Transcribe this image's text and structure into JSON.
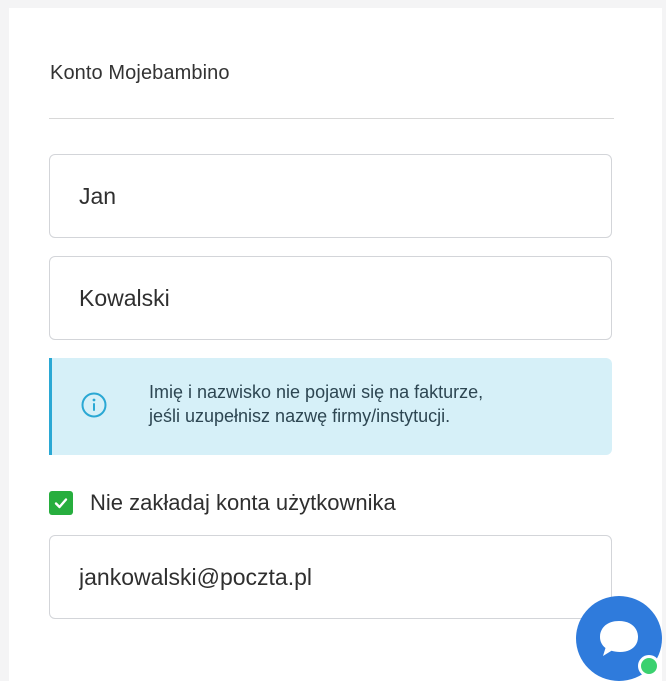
{
  "section": {
    "title": "Konto Mojebambino"
  },
  "form": {
    "first_name": {
      "value": "Jan"
    },
    "last_name": {
      "value": "Kowalski"
    },
    "info": {
      "icon": "info-icon",
      "line1": "Imię i nazwisko nie pojawi się na fakturze,",
      "line2": "jeśli uzupełnisz nazwę firmy/instytucji."
    },
    "no_account": {
      "checked": true,
      "label": "Nie zakładaj konta użytkownika"
    },
    "email": {
      "value": "jankowalski@poczta.pl"
    }
  },
  "chat": {
    "icon": "chat-bubble-icon",
    "status_color": "#3bd16f"
  },
  "colors": {
    "info_background": "#d6f0f8",
    "info_accent": "#2aa8d4",
    "checkbox": "#27ae3e",
    "chat_button": "#2f7bdc"
  }
}
